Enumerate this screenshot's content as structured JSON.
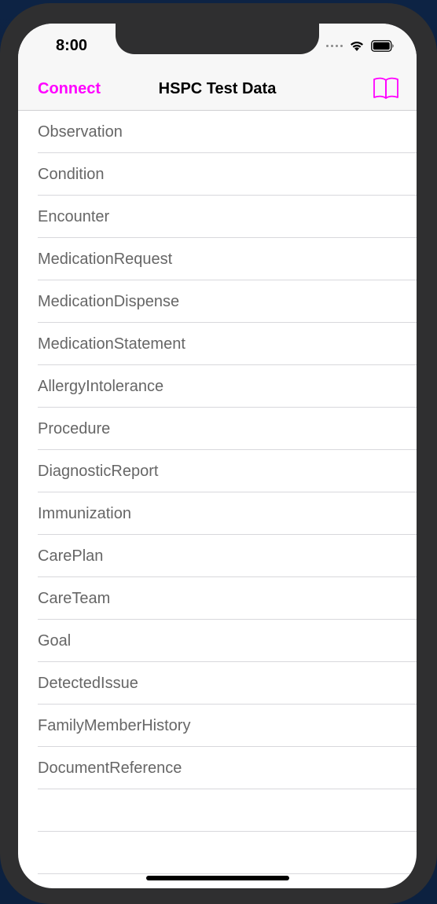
{
  "status_bar": {
    "time": "8:00"
  },
  "nav": {
    "left_label": "Connect",
    "title": "HSPC Test Data",
    "right_icon": "book-icon"
  },
  "colors": {
    "accent": "#ff00ff",
    "row_text": "#666666",
    "separator": "#d8d8dc"
  },
  "list": {
    "items": [
      "Observation",
      "Condition",
      "Encounter",
      "MedicationRequest",
      "MedicationDispense",
      "MedicationStatement",
      "AllergyIntolerance",
      "Procedure",
      "DiagnosticReport",
      "Immunization",
      "CarePlan",
      "CareTeam",
      "Goal",
      "DetectedIssue",
      "FamilyMemberHistory",
      "DocumentReference",
      "",
      ""
    ]
  }
}
